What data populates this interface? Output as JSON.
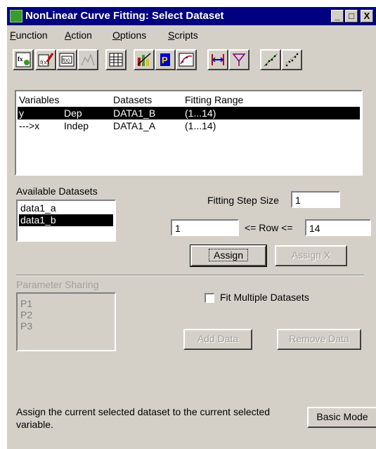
{
  "window": {
    "title": "NonLinear Curve Fitting:  Select Dataset",
    "controls": [
      "_",
      "□",
      "X"
    ]
  },
  "menu": [
    {
      "first": "F",
      "rest": "unction"
    },
    {
      "first": "A",
      "rest": "ction"
    },
    {
      "first": "O",
      "rest": "ptions"
    },
    {
      "first": "S",
      "rest": "cripts"
    }
  ],
  "toolbar_icons": [
    "function-fx-icon",
    "edit-function-icon",
    "function-table-icon",
    "distribution-icon",
    "worksheet-icon",
    "select-dataset-icon",
    "parameters-icon",
    "simulate-icon",
    "fit-range-icon",
    "weighting-icon",
    "scatter-fit-icon",
    "scatter-fit-up-icon"
  ],
  "variables": {
    "headers": [
      "Variables",
      "Datasets",
      "Fitting Range"
    ],
    "rows": [
      {
        "variable": "y",
        "type": "Dep",
        "dataset": "DATA1_B",
        "range": "(1...14)",
        "selected": true
      },
      {
        "variable": "--->x",
        "type": "Indep",
        "dataset": "DATA1_A",
        "range": "(1...14)",
        "selected": false
      }
    ]
  },
  "available": {
    "label": "Available Datasets",
    "items": [
      {
        "name": "data1_a",
        "selected": false
      },
      {
        "name": "data1_b",
        "selected": true
      }
    ]
  },
  "fitting": {
    "step_label": "Fitting Step Size",
    "step_value": "1",
    "row_from": "1",
    "row_label": "<= Row <=",
    "row_to": "14"
  },
  "buttons": {
    "assign": "Assign",
    "assign_x": "Assign X",
    "add_data": "Add Data",
    "remove_data": "Remove Data",
    "basic_mode": "Basic Mode"
  },
  "parameters": {
    "label": "Parameter Sharing",
    "items": [
      "P1",
      "P2",
      "P3"
    ]
  },
  "fit_multiple_label": "Fit Multiple Datasets",
  "status_text": "Assign the current selected dataset to the current selected variable."
}
